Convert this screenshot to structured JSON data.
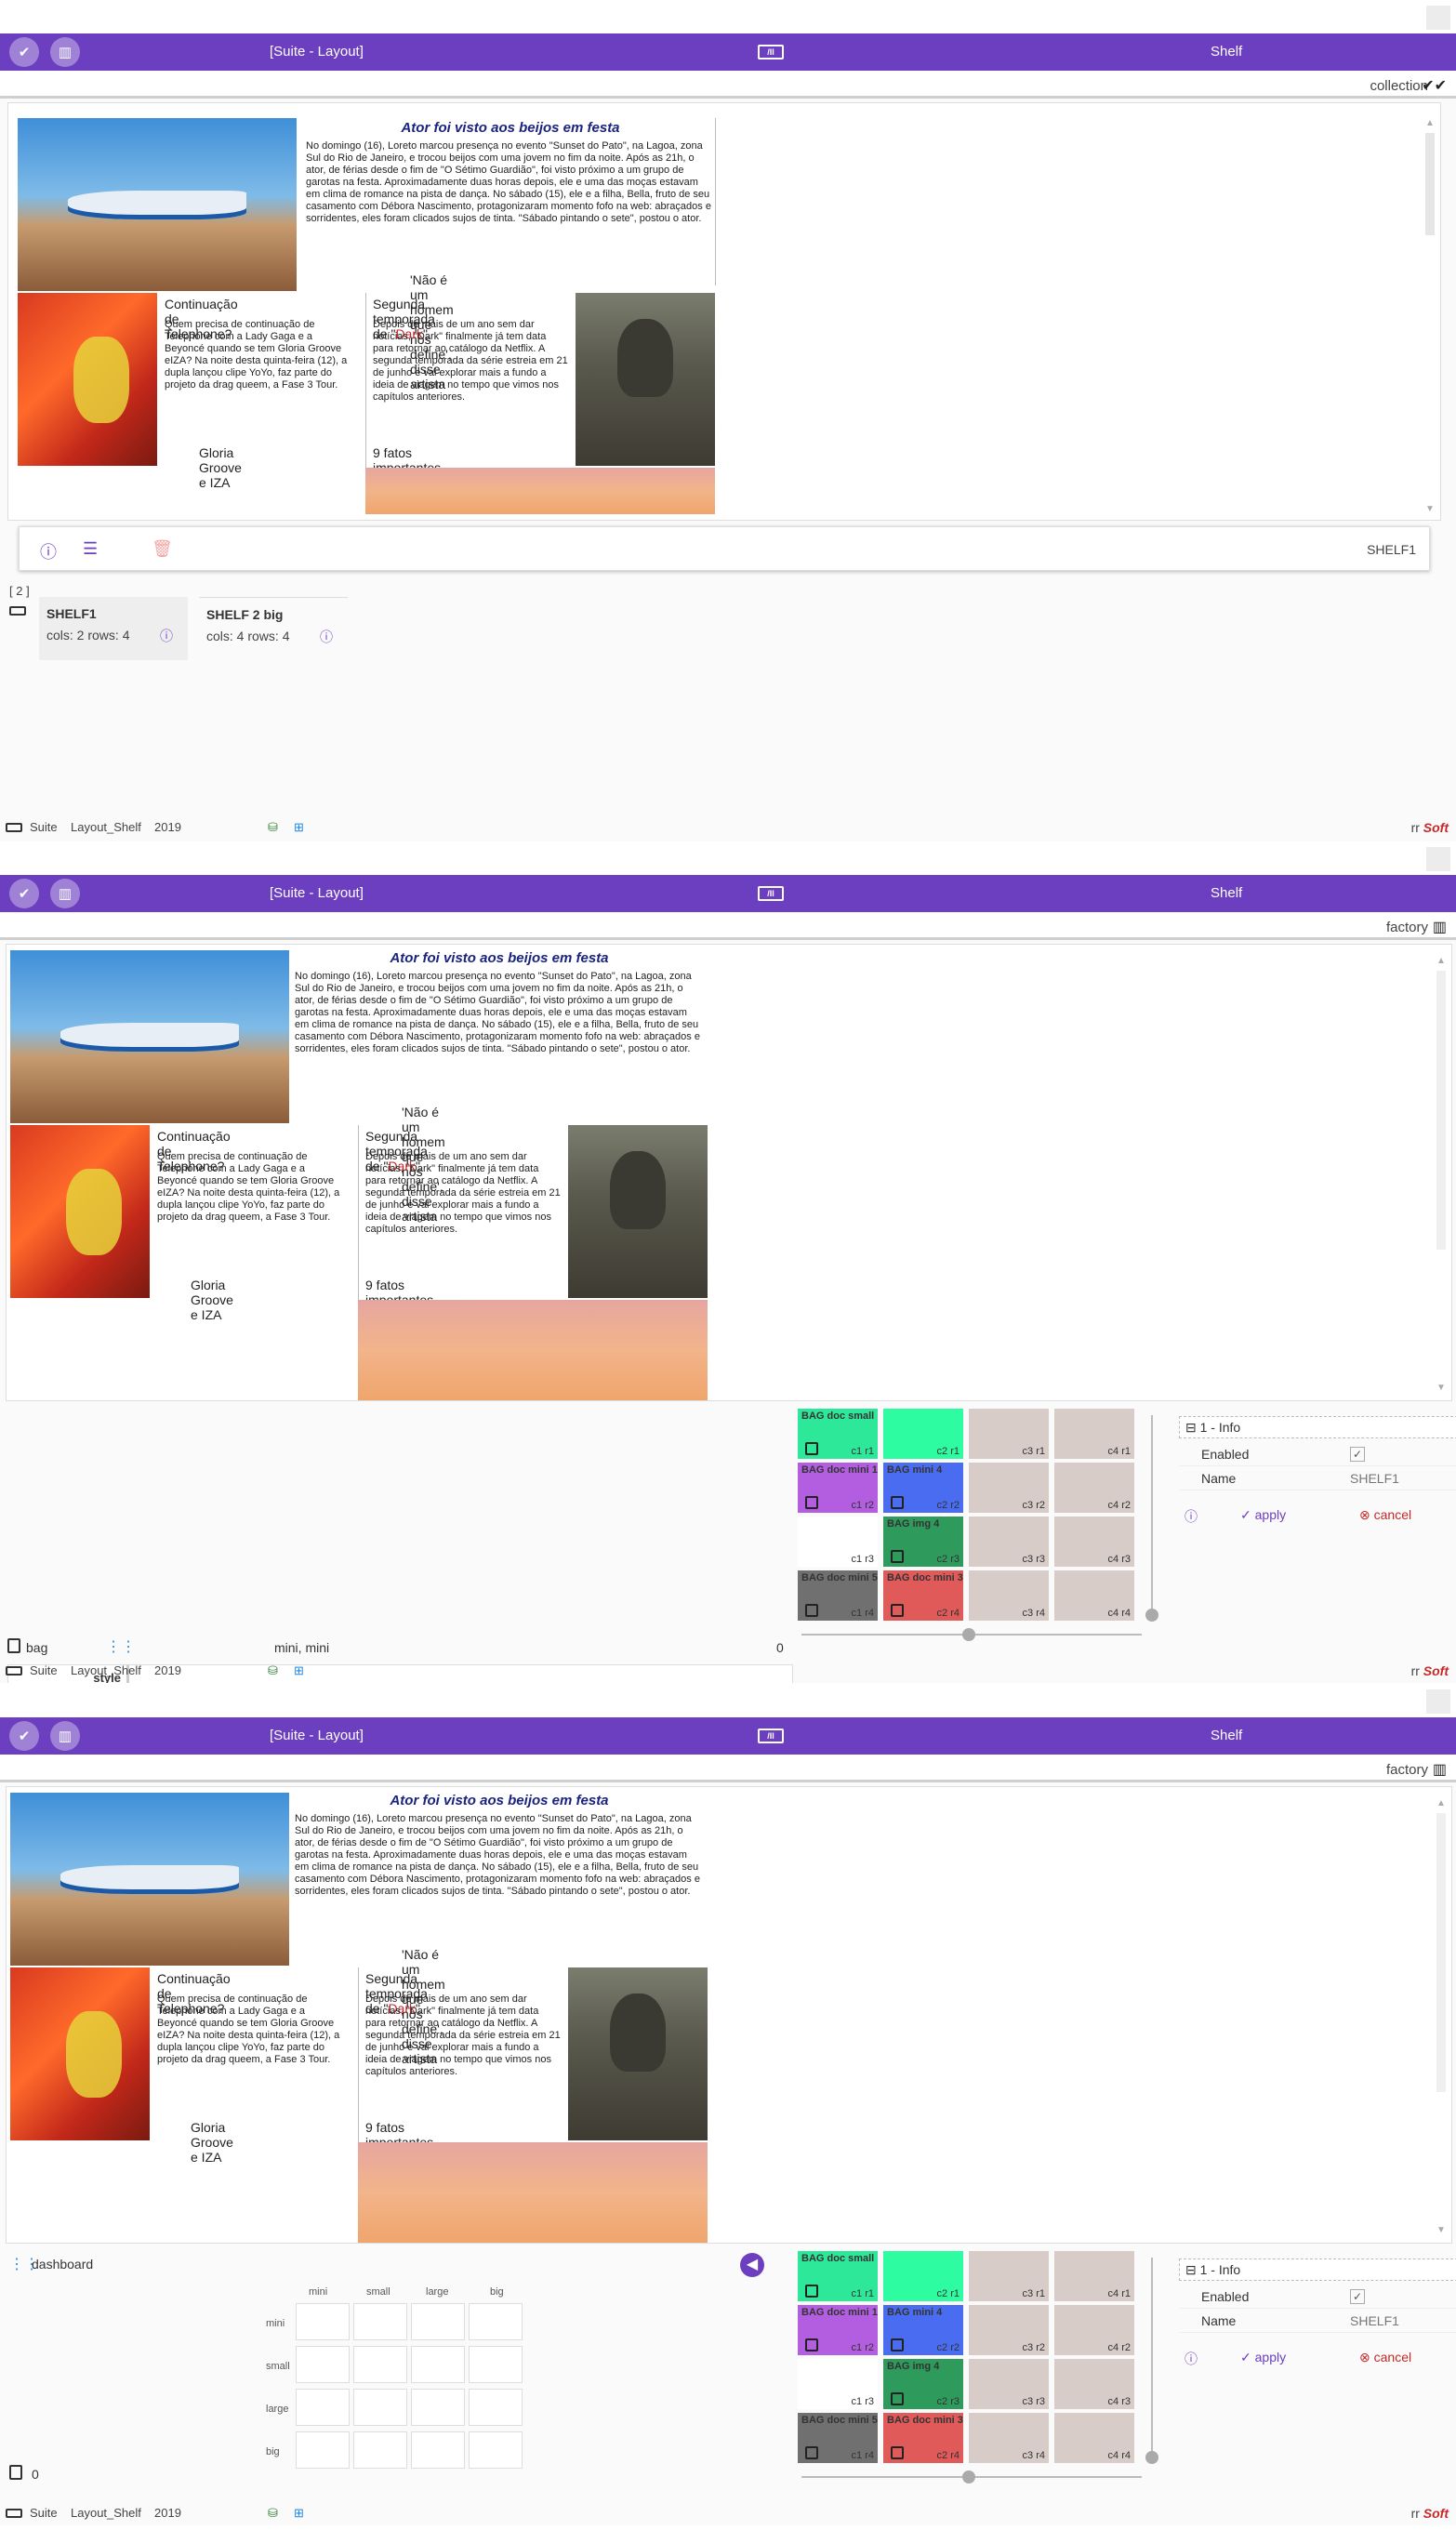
{
  "appbar": {
    "title": "[Suite - Layout]",
    "kbd": "/II",
    "right": "Shelf"
  },
  "screens": [
    {
      "sub_label": "collection"
    },
    {
      "sub_label": "factory"
    },
    {
      "sub_label": "factory"
    }
  ],
  "news": {
    "headline": "Ator foi visto aos beijos em festa",
    "body": "No domingo (16), Loreto marcou presença no evento \"Sunset do Pato\", na Lagoa, zona Sul do Rio de Janeiro, e trocou beijos com uma jovem no fim da noite. Após as 21h, o ator, de férias desde o fim de \"O Sétimo Guardião\", foi visto próximo a um grupo de garotas na festa. Aproximadamente duas horas depois, ele e uma das moças estavam em clima de romance na pista de dança. No sábado (15), ele e a filha, Bella, fruto de seu casamento com Débora Nascimento, protagonizaram momento fofo na web: abraçados e sorridentes, eles foram clicados sujos de tinta. \"Sábado pintando o sete\", postou o ator.",
    "quote": "'Não é um homem que nos define', disse artista",
    "telephone_title": "Continuação de Telephone?",
    "telephone_body": "Quem precisa de continuação de Telephone com a Lady Gaga e a Beyoncé quando se tem Gloria Groove eIZA? Na noite desta quinta-feira (12), a dupla lançou clipe YoYo, faz parte do  projeto da drag queem, a Fase 3 Tour.",
    "telephone_caption": "Gloria Groove e IZA",
    "dark_title_prefix": "Segunda temporada de \"",
    "dark_word": "Dark",
    "dark_title_suffix": "\"",
    "dark_body": "Depois de mais de um ano sem dar notícias, \"Dark\" finalmente já tem data para retornar ao catálogo da Netflix. A segunda temporada da série estreia em 21 de junho e vai explorar mais a fundo a ideia de viagem no tempo que vimos nos capítulos anteriores.",
    "facts": "9 fatos importantes"
  },
  "shelf_bar": {
    "label": "SHELF1"
  },
  "shelves": {
    "count": "[ 2 ]",
    "items": [
      {
        "name": "SHELF1",
        "desc": "cols: 2  rows: 4"
      },
      {
        "name": "SHELF 2 big",
        "desc": "cols: 4  rows: 4"
      }
    ]
  },
  "footer": {
    "suite": "Suite",
    "layout": "Layout_Shelf",
    "year": "2019",
    "brand_prefix": "rr",
    "brand": "Soft"
  },
  "bag": {
    "label": "bag",
    "size": "mini, mini",
    "count": "0",
    "style_label": "style",
    "options": [
      "mini",
      "small",
      "large",
      "big"
    ],
    "horizontal": "horizontal",
    "vertical": "vertical"
  },
  "grid_cells": [
    {
      "name": "BAG doc small",
      "label": "c1 r1",
      "color": "#2ee89a",
      "bag": true
    },
    {
      "name": "",
      "label": "c2 r1",
      "color": "#2efca0",
      "bag": false
    },
    {
      "name": "",
      "label": "c3 r1",
      "color": "#d7ccc8",
      "bag": false
    },
    {
      "name": "",
      "label": "c4 r1",
      "color": "#d7ccc8",
      "bag": false
    },
    {
      "name": "BAG doc mini 1",
      "label": "c1 r2",
      "color": "#b35ee0",
      "bag": true
    },
    {
      "name": "BAG mini 4",
      "label": "c2 r2",
      "color": "#4a6cf0",
      "bag": true
    },
    {
      "name": "",
      "label": "c3 r2",
      "color": "#d7ccc8",
      "bag": false
    },
    {
      "name": "",
      "label": "c4 r2",
      "color": "#d7ccc8",
      "bag": false
    },
    {
      "name": "",
      "label": "c1 r3",
      "color": "#ffffff",
      "bag": false
    },
    {
      "name": "BAG img 4",
      "label": "c2 r3",
      "color": "#2e9a5c",
      "bag": true
    },
    {
      "name": "",
      "label": "c3 r3",
      "color": "#d7ccc8",
      "bag": false
    },
    {
      "name": "",
      "label": "c4 r3",
      "color": "#d7ccc8",
      "bag": false
    },
    {
      "name": "BAG doc mini 5",
      "label": "c1 r4",
      "color": "#707070",
      "bag": true
    },
    {
      "name": "BAG doc mini 3",
      "label": "c2 r4",
      "color": "#e05a5a",
      "bag": true
    },
    {
      "name": "",
      "label": "c3 r4",
      "color": "#d7ccc8",
      "bag": false
    },
    {
      "name": "",
      "label": "c4 r4",
      "color": "#d7ccc8",
      "bag": false
    }
  ],
  "info": {
    "section": "1 - Info",
    "enabled_label": "Enabled",
    "name_label": "Name",
    "name_value": "SHELF1",
    "apply": "apply",
    "cancel": "cancel"
  },
  "dashboard": {
    "label": "dashboard",
    "cols": [
      "mini",
      "small",
      "large",
      "big"
    ],
    "rows": [
      "mini",
      "small",
      "large",
      "big"
    ],
    "count": "0"
  },
  "colors": {
    "accent": "#6c3fc0",
    "danger": "#c62828"
  }
}
